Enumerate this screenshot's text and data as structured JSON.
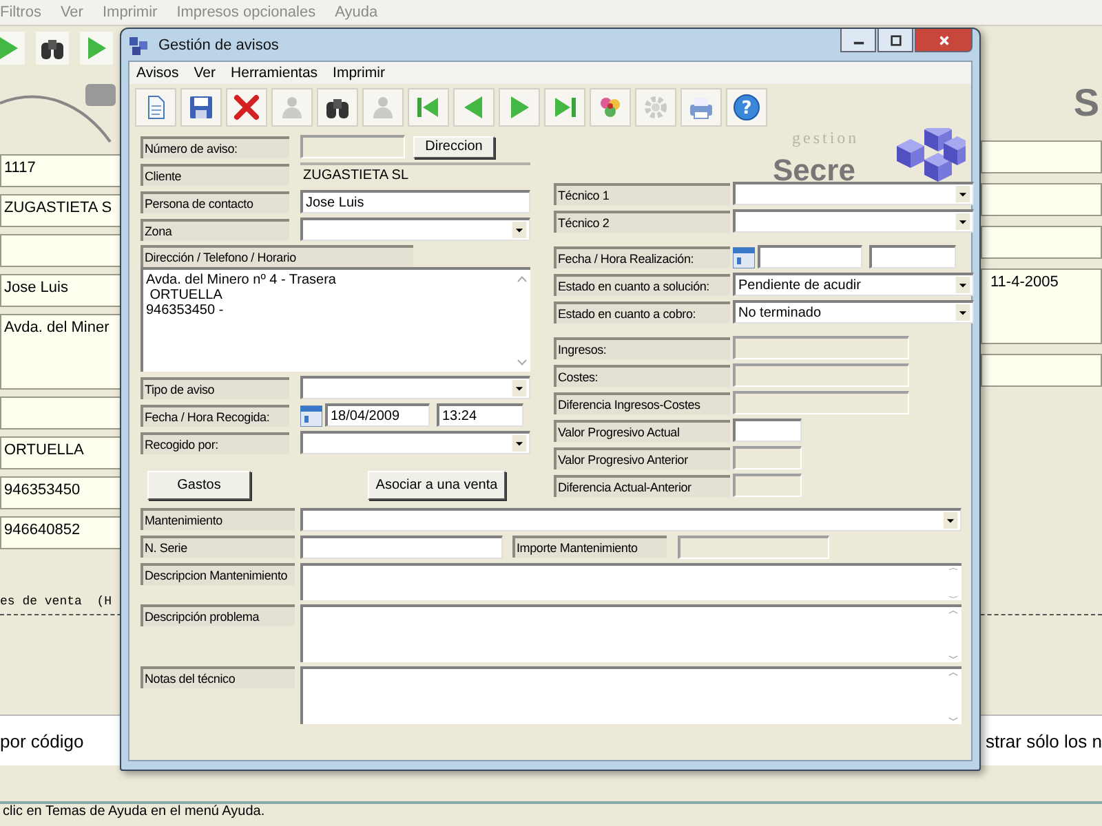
{
  "app": {
    "menu": [
      "Filtros",
      "Ver",
      "Imprimir",
      "Impresos opcionales",
      "Ayuda"
    ],
    "toolbar": [
      {
        "kind": "next"
      },
      {
        "kind": "find"
      },
      {
        "kind": "next"
      }
    ],
    "brand_letter": "S",
    "left_fields": [
      {
        "kind": "text",
        "value": "1117"
      },
      {
        "kind": "text",
        "value": "ZUGASTIETA S"
      },
      {
        "kind": "blank"
      },
      {
        "kind": "text",
        "value": "Jose Luis"
      },
      {
        "kind": "tall",
        "value": "Avda. del Miner"
      },
      {
        "kind": "blank"
      },
      {
        "kind": "text",
        "value": "ORTUELLA"
      },
      {
        "kind": "text",
        "value": "946353450"
      },
      {
        "kind": "text",
        "value": "946640852"
      }
    ],
    "right_fields": [
      {
        "kind": "blank"
      },
      {
        "kind": "blank"
      },
      {
        "kind": "blank"
      },
      {
        "kind": "tall",
        "value": "11-4-2005"
      },
      {
        "kind": "blank"
      }
    ],
    "list_header": "es de venta  (H",
    "search_label": "por código",
    "filter_label": "strar sólo los n",
    "status_bar": "clic en Temas de Ayuda en el menú Ayuda."
  },
  "dialog": {
    "title": "Gestión de avisos",
    "menu": [
      "Avisos",
      "Ver",
      "Herramientas",
      "Imprimir"
    ],
    "toolbar": [
      {
        "kind": "new",
        "disabled": false
      },
      {
        "kind": "save",
        "disabled": false
      },
      {
        "kind": "delete",
        "disabled": false
      },
      {
        "kind": "person",
        "disabled": true
      },
      {
        "kind": "find",
        "disabled": false
      },
      {
        "kind": "person",
        "disabled": true
      },
      {
        "kind": "first",
        "disabled": false
      },
      {
        "kind": "prev",
        "disabled": false
      },
      {
        "kind": "next",
        "disabled": false
      },
      {
        "kind": "last",
        "disabled": false
      },
      {
        "kind": "tools",
        "disabled": false
      },
      {
        "kind": "settings",
        "disabled": true
      },
      {
        "kind": "print",
        "disabled": false
      },
      {
        "kind": "help",
        "disabled": false,
        "glyph": "?"
      }
    ],
    "brand": {
      "tagline": "gestion",
      "name": "Secre"
    },
    "form": {
      "columns": [
        {
          "groups": [
            [
              {
                "label": "Número de aviso:",
                "kind": "readonly_short",
                "button": "Direccion"
              },
              {
                "label": "Cliente",
                "kind": "display",
                "value": "ZUGASTIETA SL"
              },
              {
                "label": "Persona de contacto",
                "kind": "text",
                "value": "Jose Luis"
              },
              {
                "label": "Zona",
                "kind": "select"
              },
              {
                "label": "Dirección / Telefono / Horario",
                "kind": "memo",
                "value": "Avda. del Minero nº 4 - Trasera\n ORTUELLA\n946353450 -"
              },
              {
                "label": "Tipo de aviso",
                "kind": "select"
              },
              {
                "label": "Fecha / Hora  Recogida:",
                "kind": "datetime",
                "date": "18/04/2009",
                "time": "13:24"
              },
              {
                "label": "Recogido por:",
                "kind": "select"
              }
            ]
          ],
          "buttons": [
            "Gastos",
            "Asociar a una venta"
          ]
        },
        {
          "groups": [
            [
              {
                "label": "Técnico 1",
                "kind": "select"
              },
              {
                "label": "Técnico 2",
                "kind": "select"
              }
            ],
            [
              {
                "label": "Fecha / Hora  Realización:",
                "kind": "datetime"
              },
              {
                "label": "Estado en cuanto a solución:",
                "kind": "select",
                "value": "Pendiente de acudir"
              },
              {
                "label": "Estado en cuanto a cobro:",
                "kind": "select",
                "value": "No terminado"
              }
            ],
            [
              {
                "label": "Ingresos:",
                "kind": "readonly_wide"
              },
              {
                "label": "Costes:",
                "kind": "readonly_wide"
              },
              {
                "label": "Diferencia Ingresos-Costes",
                "kind": "readonly_wide"
              },
              {
                "label": "Valor Progresivo Actual",
                "kind": "text_short"
              },
              {
                "label": "Valor Progresivo Anterior",
                "kind": "readonly_short"
              },
              {
                "label": "Diferencia Actual-Anterior",
                "kind": "readonly_short"
              }
            ]
          ]
        }
      ],
      "bottom_rows": [
        {
          "label": "Mantenimiento",
          "kind": "select"
        },
        {
          "label": "N. Serie",
          "kind": "pair",
          "second_label": "Importe Mantenimiento"
        },
        {
          "label": "Descripcion Mantenimiento",
          "kind": "memo_small"
        },
        {
          "label": "Descripción problema",
          "kind": "memo"
        },
        {
          "label": "Notas del técnico",
          "kind": "memo"
        }
      ]
    }
  }
}
